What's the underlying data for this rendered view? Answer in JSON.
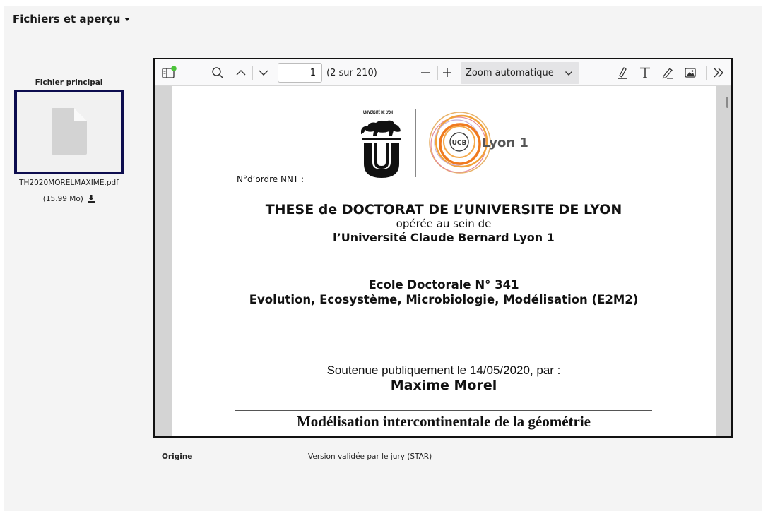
{
  "section": {
    "title": "Fichiers et aperçu"
  },
  "file": {
    "label": "Fichier principal",
    "name": "TH2020MORELMAXIME.pdf",
    "size": "(15.99 Mo)",
    "icon": "document-icon",
    "download_icon": "download-icon"
  },
  "viewer": {
    "toolbar": {
      "page_number": "1",
      "page_count": "(2 sur 210)",
      "zoom": "Zoom automatique"
    },
    "page": {
      "nnt_label": "N°d’ordre NNT :",
      "logo_left_text": "UNIVERSITÉ DE LYON",
      "logo_right_text": "Lyon 1",
      "logo_right_badge": "UCB",
      "title": "THESE de DOCTORAT DE L’UNIVERSITE DE LYON",
      "operee": "opérée au sein de",
      "university": "l’Université Claude Bernard Lyon 1",
      "ecole": "Ecole Doctorale N° 341",
      "ecole_name": "Evolution, Ecosystème, Microbiologie, Modélisation (E2M2)",
      "soutenue": "Soutenue publiquement le 14/05/2020, par :",
      "author": "Maxime Morel",
      "doc_title": "Modélisation intercontinentale de la géométrie"
    }
  },
  "meta": {
    "key": "Origine",
    "value": "Version validée par le jury (STAR)"
  },
  "colors": {
    "thumb_border": "#0d0d4f",
    "notify_dot": "#4cc43a"
  }
}
